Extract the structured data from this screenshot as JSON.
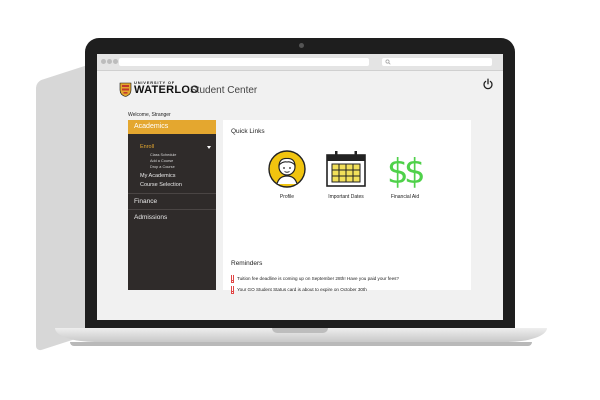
{
  "header": {
    "logo_small": "UNIVERSITY OF",
    "logo_large": "WATERLOO",
    "app_title": "Student Center"
  },
  "welcome": "Welcome, Stranger",
  "sidebar": {
    "academics": "Academics",
    "enroll": "Enroll",
    "enroll_items": [
      "Class Schedule",
      "Add a Course",
      "Drop a Course"
    ],
    "my_academics": "My Academics",
    "course_selection": "Course Selection",
    "finance": "Finance",
    "admissions": "Admissions"
  },
  "quick_links": {
    "title": "Quick Links",
    "items": [
      {
        "label": "Profile",
        "icon": "profile-avatar-icon"
      },
      {
        "label": "Important Dates",
        "icon": "calendar-icon"
      },
      {
        "label": "Financial Aid",
        "icon": "dollar-icon"
      }
    ]
  },
  "reminders": {
    "title": "Reminders",
    "items": [
      "Tuition fee deadline is coming up on September 28th! Have you paid your fees?",
      "Your GO Student Status card is about to expire on October 30th"
    ]
  },
  "colors": {
    "accent": "#e4a72f",
    "sidebar_bg": "#2f2b2a",
    "dollar_green": "#4fd14a",
    "alert_red": "#e04646",
    "calendar_fill": "#f2e05a"
  }
}
